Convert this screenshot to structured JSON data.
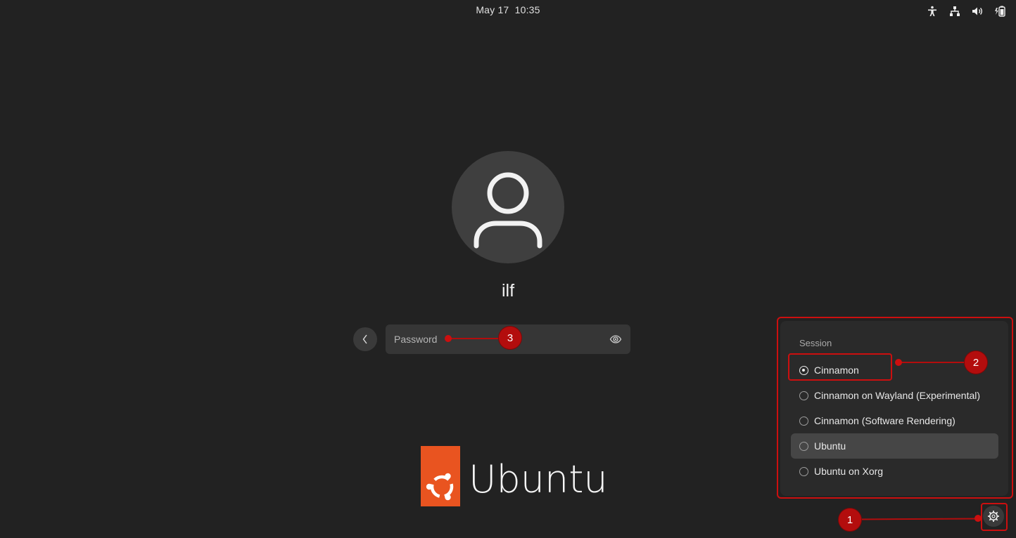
{
  "topbar": {
    "date": "May 17",
    "time": "10:35",
    "icons": [
      "accessibility-icon",
      "network-icon",
      "volume-icon",
      "battery-icon"
    ]
  },
  "login": {
    "username": "ilf",
    "password_placeholder": "Password",
    "password_value": ""
  },
  "logo": {
    "wordmark": "Ubuntu",
    "brand_color": "#E95420"
  },
  "session_menu": {
    "title": "Session",
    "items": [
      {
        "label": "Cinnamon",
        "selected": true
      },
      {
        "label": "Cinnamon on Wayland (Experimental)",
        "selected": false
      },
      {
        "label": "Cinnamon (Software Rendering)",
        "selected": false
      },
      {
        "label": "Ubuntu",
        "selected": false,
        "hovered": true
      },
      {
        "label": "Ubuntu on Xorg",
        "selected": false
      }
    ]
  },
  "annotations": {
    "color": "#CC0F0F",
    "markers": [
      "1",
      "2",
      "3"
    ]
  }
}
